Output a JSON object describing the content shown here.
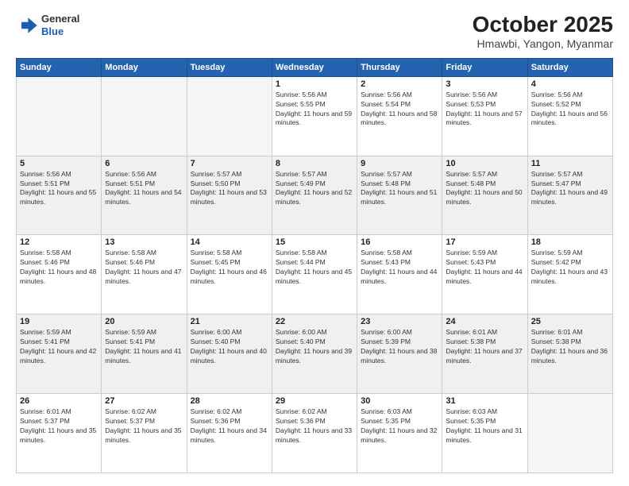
{
  "logo": {
    "line1": "General",
    "line2": "Blue"
  },
  "header": {
    "month": "October 2025",
    "location": "Hmawbi, Yangon, Myanmar"
  },
  "weekdays": [
    "Sunday",
    "Monday",
    "Tuesday",
    "Wednesday",
    "Thursday",
    "Friday",
    "Saturday"
  ],
  "weeks": [
    [
      {
        "day": "",
        "sunrise": "",
        "sunset": "",
        "daylight": ""
      },
      {
        "day": "",
        "sunrise": "",
        "sunset": "",
        "daylight": ""
      },
      {
        "day": "",
        "sunrise": "",
        "sunset": "",
        "daylight": ""
      },
      {
        "day": "1",
        "sunrise": "Sunrise: 5:56 AM",
        "sunset": "Sunset: 5:55 PM",
        "daylight": "Daylight: 11 hours and 59 minutes."
      },
      {
        "day": "2",
        "sunrise": "Sunrise: 5:56 AM",
        "sunset": "Sunset: 5:54 PM",
        "daylight": "Daylight: 11 hours and 58 minutes."
      },
      {
        "day": "3",
        "sunrise": "Sunrise: 5:56 AM",
        "sunset": "Sunset: 5:53 PM",
        "daylight": "Daylight: 11 hours and 57 minutes."
      },
      {
        "day": "4",
        "sunrise": "Sunrise: 5:56 AM",
        "sunset": "Sunset: 5:52 PM",
        "daylight": "Daylight: 11 hours and 56 minutes."
      }
    ],
    [
      {
        "day": "5",
        "sunrise": "Sunrise: 5:56 AM",
        "sunset": "Sunset: 5:51 PM",
        "daylight": "Daylight: 11 hours and 55 minutes."
      },
      {
        "day": "6",
        "sunrise": "Sunrise: 5:56 AM",
        "sunset": "Sunset: 5:51 PM",
        "daylight": "Daylight: 11 hours and 54 minutes."
      },
      {
        "day": "7",
        "sunrise": "Sunrise: 5:57 AM",
        "sunset": "Sunset: 5:50 PM",
        "daylight": "Daylight: 11 hours and 53 minutes."
      },
      {
        "day": "8",
        "sunrise": "Sunrise: 5:57 AM",
        "sunset": "Sunset: 5:49 PM",
        "daylight": "Daylight: 11 hours and 52 minutes."
      },
      {
        "day": "9",
        "sunrise": "Sunrise: 5:57 AM",
        "sunset": "Sunset: 5:48 PM",
        "daylight": "Daylight: 11 hours and 51 minutes."
      },
      {
        "day": "10",
        "sunrise": "Sunrise: 5:57 AM",
        "sunset": "Sunset: 5:48 PM",
        "daylight": "Daylight: 11 hours and 50 minutes."
      },
      {
        "day": "11",
        "sunrise": "Sunrise: 5:57 AM",
        "sunset": "Sunset: 5:47 PM",
        "daylight": "Daylight: 11 hours and 49 minutes."
      }
    ],
    [
      {
        "day": "12",
        "sunrise": "Sunrise: 5:58 AM",
        "sunset": "Sunset: 5:46 PM",
        "daylight": "Daylight: 11 hours and 48 minutes."
      },
      {
        "day": "13",
        "sunrise": "Sunrise: 5:58 AM",
        "sunset": "Sunset: 5:46 PM",
        "daylight": "Daylight: 11 hours and 47 minutes."
      },
      {
        "day": "14",
        "sunrise": "Sunrise: 5:58 AM",
        "sunset": "Sunset: 5:45 PM",
        "daylight": "Daylight: 11 hours and 46 minutes."
      },
      {
        "day": "15",
        "sunrise": "Sunrise: 5:58 AM",
        "sunset": "Sunset: 5:44 PM",
        "daylight": "Daylight: 11 hours and 45 minutes."
      },
      {
        "day": "16",
        "sunrise": "Sunrise: 5:58 AM",
        "sunset": "Sunset: 5:43 PM",
        "daylight": "Daylight: 11 hours and 44 minutes."
      },
      {
        "day": "17",
        "sunrise": "Sunrise: 5:59 AM",
        "sunset": "Sunset: 5:43 PM",
        "daylight": "Daylight: 11 hours and 44 minutes."
      },
      {
        "day": "18",
        "sunrise": "Sunrise: 5:59 AM",
        "sunset": "Sunset: 5:42 PM",
        "daylight": "Daylight: 11 hours and 43 minutes."
      }
    ],
    [
      {
        "day": "19",
        "sunrise": "Sunrise: 5:59 AM",
        "sunset": "Sunset: 5:41 PM",
        "daylight": "Daylight: 11 hours and 42 minutes."
      },
      {
        "day": "20",
        "sunrise": "Sunrise: 5:59 AM",
        "sunset": "Sunset: 5:41 PM",
        "daylight": "Daylight: 11 hours and 41 minutes."
      },
      {
        "day": "21",
        "sunrise": "Sunrise: 6:00 AM",
        "sunset": "Sunset: 5:40 PM",
        "daylight": "Daylight: 11 hours and 40 minutes."
      },
      {
        "day": "22",
        "sunrise": "Sunrise: 6:00 AM",
        "sunset": "Sunset: 5:40 PM",
        "daylight": "Daylight: 11 hours and 39 minutes."
      },
      {
        "day": "23",
        "sunrise": "Sunrise: 6:00 AM",
        "sunset": "Sunset: 5:39 PM",
        "daylight": "Daylight: 11 hours and 38 minutes."
      },
      {
        "day": "24",
        "sunrise": "Sunrise: 6:01 AM",
        "sunset": "Sunset: 5:38 PM",
        "daylight": "Daylight: 11 hours and 37 minutes."
      },
      {
        "day": "25",
        "sunrise": "Sunrise: 6:01 AM",
        "sunset": "Sunset: 5:38 PM",
        "daylight": "Daylight: 11 hours and 36 minutes."
      }
    ],
    [
      {
        "day": "26",
        "sunrise": "Sunrise: 6:01 AM",
        "sunset": "Sunset: 5:37 PM",
        "daylight": "Daylight: 11 hours and 35 minutes."
      },
      {
        "day": "27",
        "sunrise": "Sunrise: 6:02 AM",
        "sunset": "Sunset: 5:37 PM",
        "daylight": "Daylight: 11 hours and 35 minutes."
      },
      {
        "day": "28",
        "sunrise": "Sunrise: 6:02 AM",
        "sunset": "Sunset: 5:36 PM",
        "daylight": "Daylight: 11 hours and 34 minutes."
      },
      {
        "day": "29",
        "sunrise": "Sunrise: 6:02 AM",
        "sunset": "Sunset: 5:36 PM",
        "daylight": "Daylight: 11 hours and 33 minutes."
      },
      {
        "day": "30",
        "sunrise": "Sunrise: 6:03 AM",
        "sunset": "Sunset: 5:35 PM",
        "daylight": "Daylight: 11 hours and 32 minutes."
      },
      {
        "day": "31",
        "sunrise": "Sunrise: 6:03 AM",
        "sunset": "Sunset: 5:35 PM",
        "daylight": "Daylight: 11 hours and 31 minutes."
      },
      {
        "day": "",
        "sunrise": "",
        "sunset": "",
        "daylight": ""
      }
    ]
  ]
}
